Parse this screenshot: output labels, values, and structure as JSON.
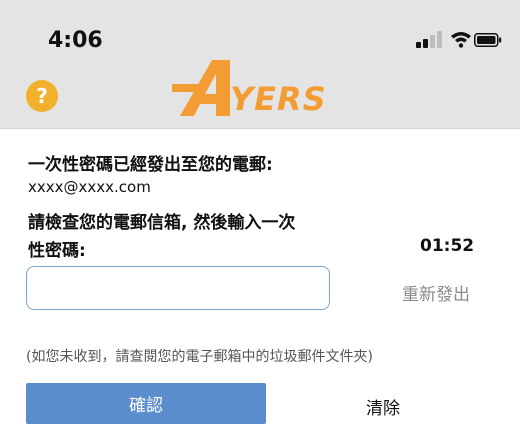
{
  "status_bar": {
    "time": "4:06"
  },
  "header": {
    "help_icon": "question-circle-icon",
    "help_glyph": "?",
    "logo_text": "AYERS",
    "logo_color": "#f39c34"
  },
  "main": {
    "line1": "一次性密碼已經發出至您的電郵:",
    "email": "xxxx@xxxx.com",
    "line2": "請檢查您的電郵信箱, 然後輸入一次",
    "line3": "性密碼:",
    "timer": "01:52",
    "otp_value": "",
    "otp_placeholder": "",
    "resend_label": "重新發出",
    "note": "(如您未收到，請查閱您的電子郵箱中的垃圾郵件文件夾)",
    "confirm_label": "確認",
    "clear_label": "清除"
  },
  "colors": {
    "accent": "#5b8ccb",
    "help": "#f2b02c",
    "input_border": "#7aa4d6"
  }
}
